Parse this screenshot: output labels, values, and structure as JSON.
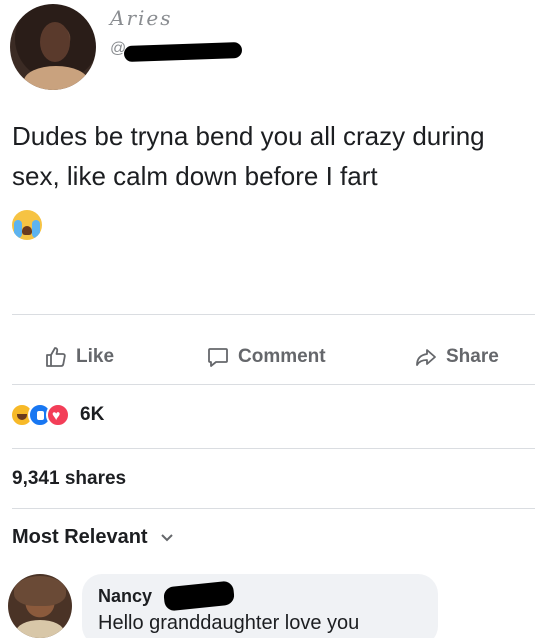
{
  "post": {
    "author_name": "Aries",
    "handle_prefix": "@",
    "text": "Dudes be tryna bend you all crazy during sex, like calm down before I fart",
    "emoji_icon": "loudly-crying-face-icon"
  },
  "actions": {
    "like_label": "Like",
    "comment_label": "Comment",
    "share_label": "Share"
  },
  "reactions": {
    "icons": [
      "haha-reaction-icon",
      "like-reaction-icon",
      "love-reaction-icon"
    ],
    "count": "6K"
  },
  "shares": "9,341 shares",
  "comments_sort": {
    "label": "Most Relevant",
    "icon": "chevron-down-icon"
  },
  "comments": [
    {
      "author": "Nancy",
      "text": "Hello granddaughter love you"
    }
  ],
  "colors": {
    "secondary_text": "#65676b",
    "like_blue": "#1877f2",
    "love_red": "#f33e58",
    "haha_yellow": "#f7b928",
    "comment_bubble": "#f0f2f5"
  }
}
